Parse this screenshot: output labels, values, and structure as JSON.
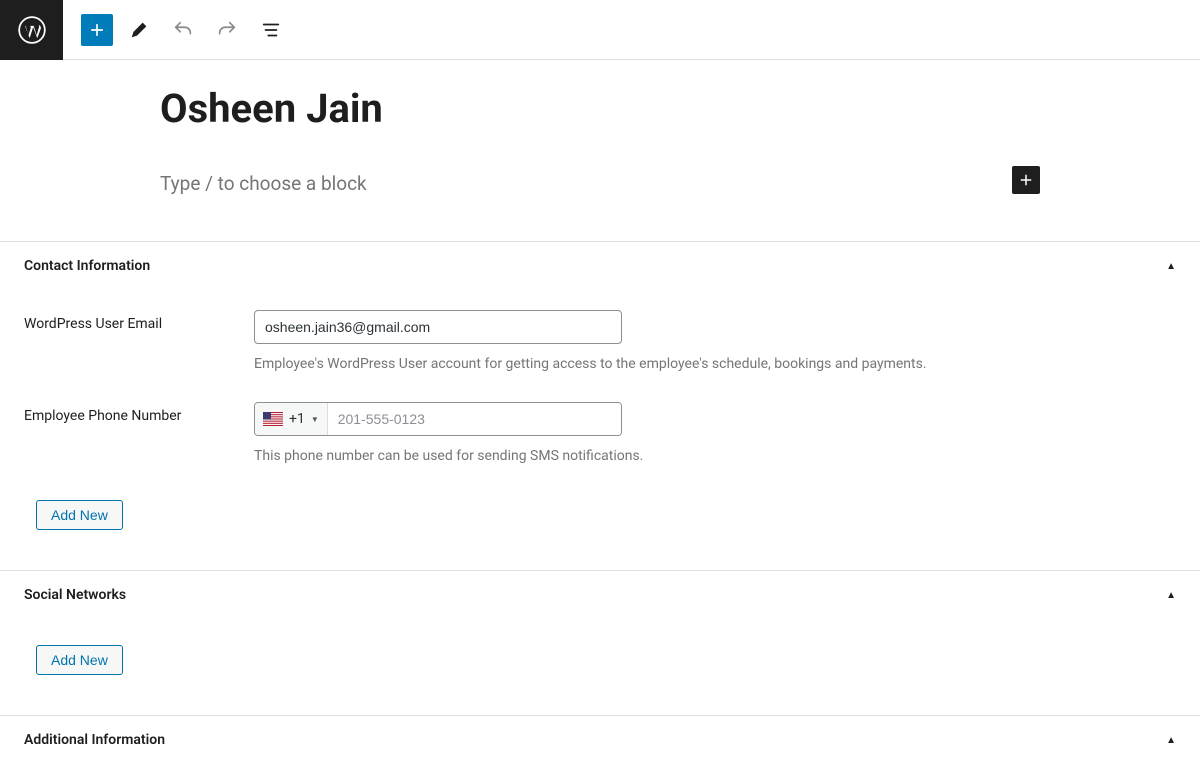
{
  "editor": {
    "title": "Osheen Jain",
    "block_placeholder": "Type / to choose a block"
  },
  "sections": {
    "contact": {
      "title": "Contact Information",
      "email_label": "WordPress User Email",
      "email_value": "osheen.jain36@gmail.com",
      "email_help": "Employee's WordPress User account for getting access to the employee's schedule, bookings and payments.",
      "phone_label": "Employee Phone Number",
      "phone_dial_code": "+1",
      "phone_placeholder": "201-555-0123",
      "phone_help": "This phone number can be used for sending SMS notifications.",
      "add_new": "Add New"
    },
    "social": {
      "title": "Social Networks",
      "add_new": "Add New"
    },
    "additional": {
      "title": "Additional Information"
    }
  }
}
